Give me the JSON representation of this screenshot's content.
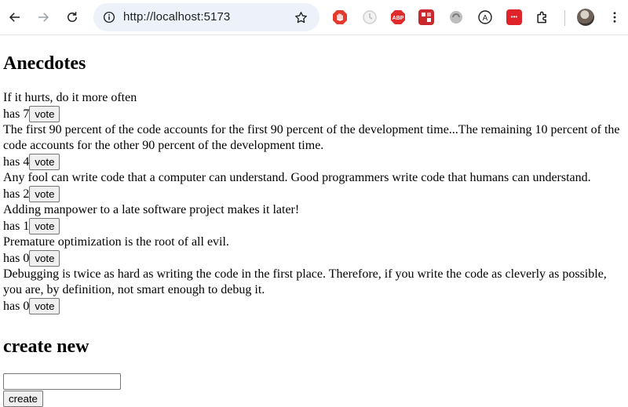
{
  "browser": {
    "url": "http://localhost:5173",
    "extensions": [
      "hand-stop-extension-icon",
      "clock-extension-icon",
      "adblock-plus-icon",
      "puzzle-red-extension-icon",
      "grey-swirl-extension-icon",
      "a-circle-extension-icon",
      "red-dots-extension-icon"
    ],
    "extension_labels": {
      "abp": "ABP",
      "a": "A",
      "dots": "•••"
    },
    "accent_colors": {
      "omnibox_bg": "#edf2fa",
      "adblock_red": "#e02b2b"
    }
  },
  "page": {
    "title": "Anecdotes",
    "vote_prefix": "has",
    "vote_button": "vote",
    "anecdotes": [
      {
        "text": "If it hurts, do it more often",
        "votes": "7"
      },
      {
        "text": "The first 90 percent of the code accounts for the first 90 percent of the development time...The remaining 10 percent of the code accounts for the other 90 percent of the development time.",
        "votes": "4"
      },
      {
        "text": "Any fool can write code that a computer can understand. Good programmers write code that humans can understand.",
        "votes": "2"
      },
      {
        "text": "Adding manpower to a late software project makes it later!",
        "votes": "1"
      },
      {
        "text": "Premature optimization is the root of all evil.",
        "votes": "0"
      },
      {
        "text": "Debugging is twice as hard as writing the code in the first place. Therefore, if you write the code as cleverly as possible, you are, by definition, not smart enough to debug it.",
        "votes": "0"
      }
    ],
    "create_title": "create new",
    "new_input_value": "",
    "create_button": "create"
  }
}
